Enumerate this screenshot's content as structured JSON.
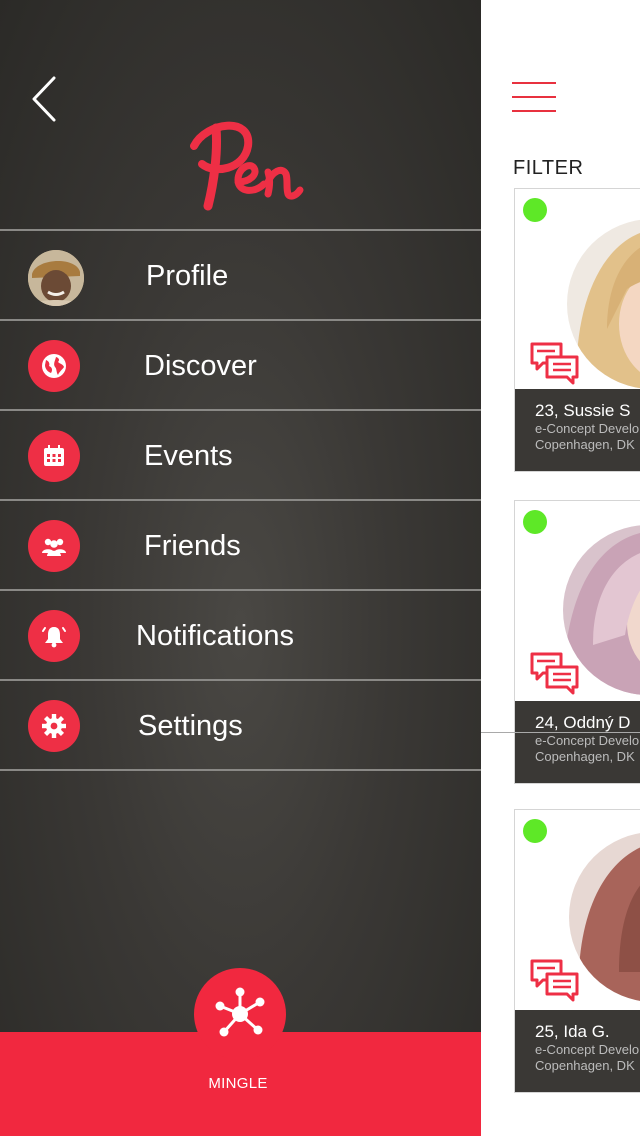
{
  "colors": {
    "accent": "#ee2f45",
    "drawer_bg": "#3a3835",
    "online": "#5ee827",
    "card_info_bg": "#3a3835"
  },
  "drawer": {
    "logo_text": "Pen",
    "back_icon": "chevron-left-icon",
    "menu": [
      {
        "label": "Profile",
        "icon": "avatar"
      },
      {
        "label": "Discover",
        "icon": "globe-icon"
      },
      {
        "label": "Events",
        "icon": "calendar-icon"
      },
      {
        "label": "Friends",
        "icon": "people-icon"
      },
      {
        "label": "Notifications",
        "icon": "bell-icon"
      },
      {
        "label": "Settings",
        "icon": "gear-icon"
      }
    ],
    "mingle": {
      "label": "MINGLE",
      "icon": "network-icon"
    }
  },
  "content": {
    "menu_icon": "hamburger-icon",
    "filter_label": "FILTER",
    "cards": [
      {
        "name": "23, Sussie S",
        "job": "e-Concept Develo",
        "location": "Copenhagen, DK"
      },
      {
        "name": "24, Oddný D",
        "job": "e-Concept Develo",
        "location": "Copenhagen, DK"
      },
      {
        "name": "25, Ida G.",
        "job": "e-Concept Develo",
        "location": "Copenhagen, DK"
      }
    ]
  }
}
